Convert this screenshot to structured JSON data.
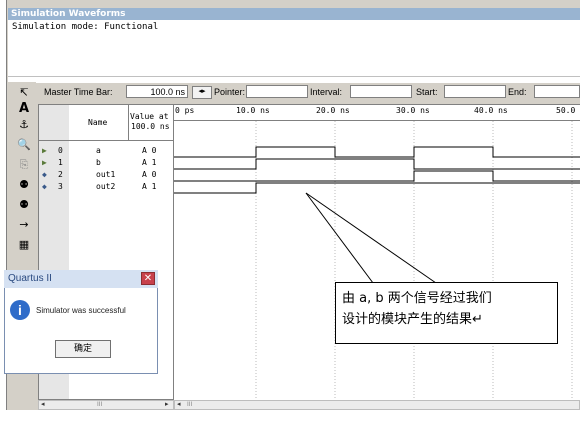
{
  "window": {
    "title": "Simulation Waveforms",
    "mode_line": "Simulation mode: Functional"
  },
  "toolbar": {
    "master_label": "Master Time Bar:",
    "master_value": "100.0 ns",
    "pointer_label": "Pointer:",
    "pointer_value": "",
    "interval_label": "Interval:",
    "interval_value": "",
    "start_label": "Start:",
    "start_value": "",
    "end_label": "End:",
    "end_value": ""
  },
  "tools": [
    "pointer-icon",
    "text-tool-icon",
    "node-finder-icon",
    "zoom-icon",
    "copy-icon",
    "find-icon",
    "find-next-icon",
    "arrow-icon",
    "node-group-icon"
  ],
  "table": {
    "name_header": "Name",
    "value_header_line1": "Value at",
    "value_header_line2": "100.0 ns",
    "rows": [
      {
        "index": "0",
        "name": "a",
        "value": "A 0"
      },
      {
        "index": "1",
        "name": "b",
        "value": "A 1"
      },
      {
        "index": "2",
        "name": "out1",
        "value": "A 0"
      },
      {
        "index": "3",
        "name": "out2",
        "value": "A 1"
      }
    ]
  },
  "ruler": {
    "ticks": [
      "0 ps",
      "10.0 ns",
      "20.0 ns",
      "30.0 ns",
      "40.0 ns",
      "50.0"
    ]
  },
  "dialog": {
    "title": "Quartus II",
    "message": "Simulator was successful",
    "ok_label": "确定"
  },
  "annotation": {
    "line1": "由 a, b 两个信号经过我们",
    "line2": "设计的模块产生的结果↵"
  },
  "scroll_left_label": "III",
  "scroll_right_label": "III"
}
